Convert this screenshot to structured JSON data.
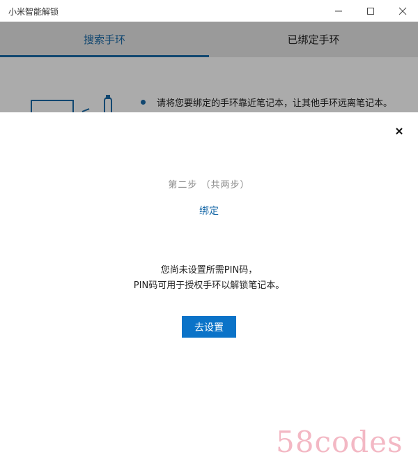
{
  "window": {
    "title": "小米智能解锁",
    "controls": [
      "minimize-icon",
      "maximize-icon",
      "close-icon"
    ]
  },
  "tabs": [
    {
      "label": "搜索手环",
      "active": true
    },
    {
      "label": "已绑定手环",
      "active": false
    }
  ],
  "background_page": {
    "hint": "请将您要绑定的手环靠近笔记本，让其他手环远离笔记本。"
  },
  "dialog": {
    "close_icon": "close-icon",
    "step": "第二步 （共两步）",
    "step_title": "绑定",
    "message_line1": "您尚未设置所需PIN码，",
    "message_line2": "PIN码可用于授权手环以解锁笔记本。",
    "button_label": "去设置"
  },
  "watermark": "58codes",
  "colors": {
    "accent": "#1a6aa8",
    "button": "#0b73c8",
    "tabbar": "#e6e6e6",
    "watermark": "#f3b8c4"
  }
}
